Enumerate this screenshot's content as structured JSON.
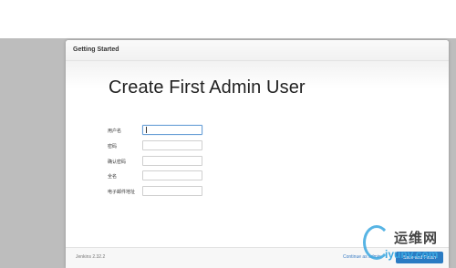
{
  "dialog": {
    "header_title": "Getting Started",
    "page_title": "Create First Admin User"
  },
  "form": {
    "fields": [
      {
        "label": "用户名",
        "value": "",
        "focused": true
      },
      {
        "label": "密码",
        "value": ""
      },
      {
        "label": "确认密码",
        "value": ""
      },
      {
        "label": "全名",
        "value": ""
      },
      {
        "label": "电子邮件地址",
        "value": ""
      }
    ]
  },
  "footer": {
    "version": "Jenkins 2.32.2",
    "continue_label": "Continue as admin",
    "save_label": "Save and Finish"
  },
  "watermark": {
    "text_main": "运维网",
    "text_sub": "iyunv.com"
  },
  "colors": {
    "backdrop": "#bdbdbd",
    "accent": "#2a7bc3",
    "link": "#3a7cc4",
    "watermark": "#3aa7e0"
  }
}
